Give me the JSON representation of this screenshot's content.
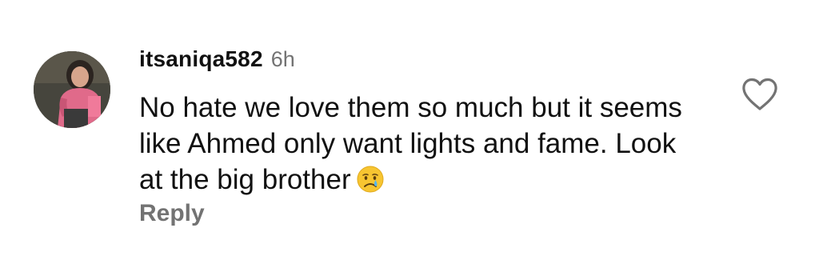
{
  "comment": {
    "username": "itsaniqa582",
    "time": "6h",
    "text": "No hate we love them so much but it seems like Ahmed only want lights and fame. Look at the big brother",
    "emoji_icon": "crying-face-icon",
    "reply_label": "Reply",
    "like_icon": "heart-outline-icon"
  }
}
